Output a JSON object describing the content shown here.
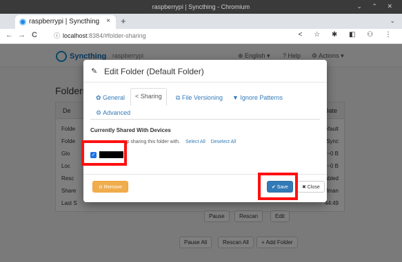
{
  "window": {
    "title": "raspberrypi | Syncthing - Chromium",
    "controls": "⌄ ⌃ ✕"
  },
  "browser": {
    "tab_title": "raspberrypi | Syncthing",
    "tab_close": "×",
    "new_tab": "+",
    "tab_menu": "⌄",
    "back": "←",
    "forward": "→",
    "reload": "C",
    "info_icon": "ⓘ",
    "url_host": "localhost",
    "url_path": ":8384/#folder-sharing",
    "toolbar_icons": "< ☆ ✱ ◧ ⚇ ⋮"
  },
  "page": {
    "brand": "Syncthing",
    "device_name": "raspberrypi",
    "language": "⊕ English ▾",
    "help": "? Help",
    "actions": "⚙ Actions ▾",
    "folders_heading": "Folders",
    "panel_left": "De",
    "panel_right": "Date",
    "rows": [
      {
        "label": "Folde",
        "value": "default"
      },
      {
        "label": "Folde",
        "value": "a/Sync"
      },
      {
        "label": "Glo",
        "value": "~0 B"
      },
      {
        "label": "Loc",
        "value": "~0 B"
      },
      {
        "label": "Resc",
        "value": "nabled"
      },
      {
        "label": "Share",
        "value": "orfman"
      },
      {
        "label": "Last S",
        "value": "44:49"
      }
    ],
    "pause_button": "Pause",
    "rescan_button": "Rescan",
    "edit_button": "Edit",
    "pause_all_button": "Pause All",
    "rescan_all_button": "Rescan All",
    "add_folder_button": "+ Add Folder"
  },
  "modal": {
    "title": "Edit Folder (Default Folder)",
    "tabs": {
      "general": "✿ General",
      "sharing": "< Sharing",
      "versioning": "⧉ File Versioning",
      "ignore": "▼ Ignore Patterns",
      "advanced": "⚙ Advanced"
    },
    "section_heading": "Currently Shared With Devices",
    "hint_text": "s to stop sharing this folder with.",
    "select_all": "Select All",
    "deselect_all": "Deselect All",
    "device_checked": "✓",
    "remove_button": "⊖ Remove",
    "save_button": "✔ Save",
    "close_button": "✖ Close"
  }
}
